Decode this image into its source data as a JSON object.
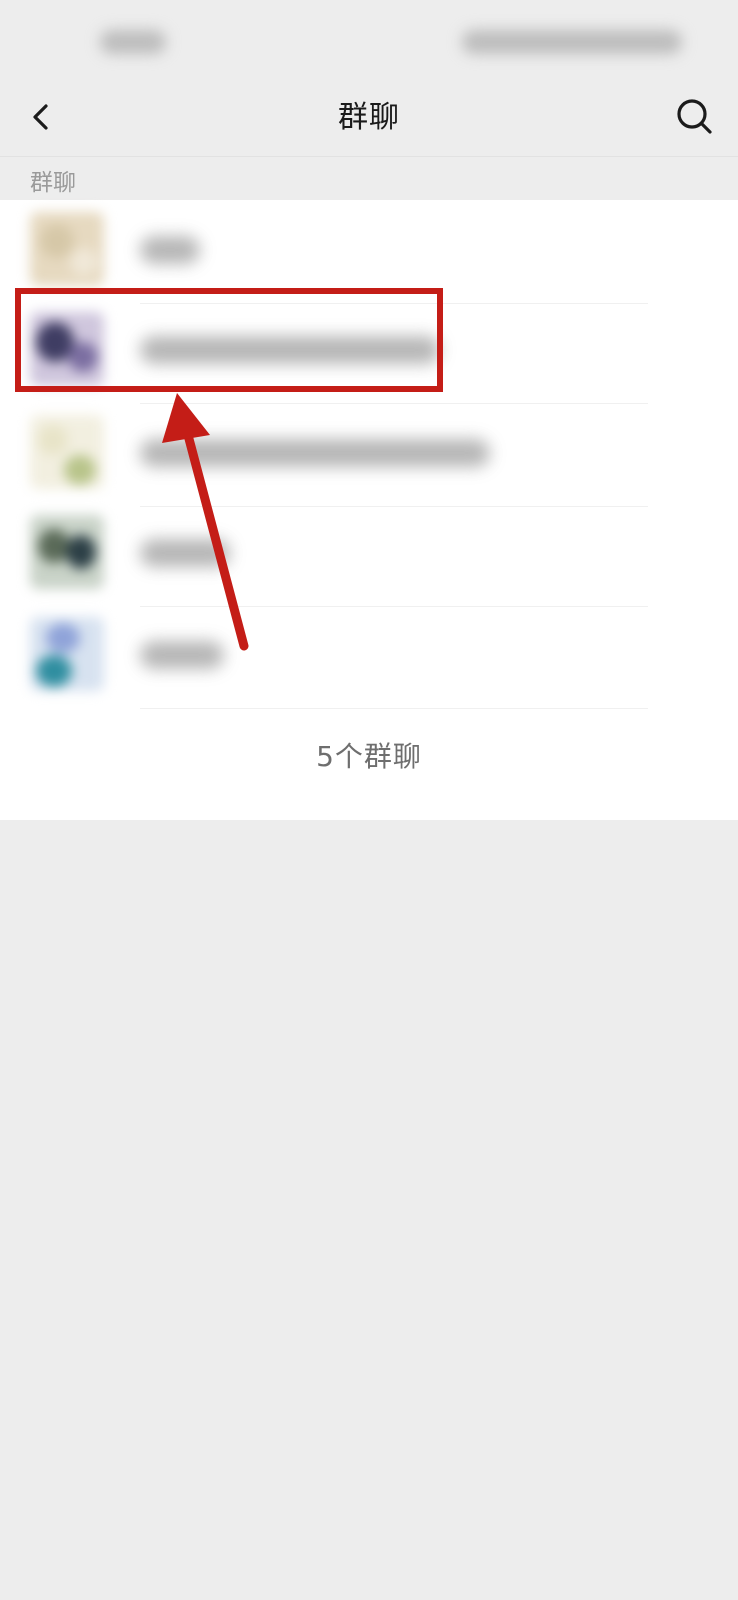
{
  "nav": {
    "title": "群聊",
    "back_icon": "chevron-left-icon",
    "search_icon": "search-icon"
  },
  "section": {
    "header": "群聊"
  },
  "groups": [
    {
      "avatar_colors": [
        "#e6d9c0",
        "#d6c8a8",
        "#f0e8d8"
      ]
    },
    {
      "avatar_colors": [
        "#3f3d63",
        "#7b6ea1",
        "#cfc6dd"
      ]
    },
    {
      "avatar_colors": [
        "#e8e4c8",
        "#b8c48a",
        "#f2efe0"
      ]
    },
    {
      "avatar_colors": [
        "#5a6a58",
        "#2c3f46",
        "#c9d3c8"
      ]
    },
    {
      "avatar_colors": [
        "#8fa3d9",
        "#2f8ea0",
        "#d7e2f0"
      ]
    }
  ],
  "footer": {
    "count_label": "5个群聊"
  },
  "colors": {
    "annotation": "#c41d17",
    "background": "#ededed"
  }
}
